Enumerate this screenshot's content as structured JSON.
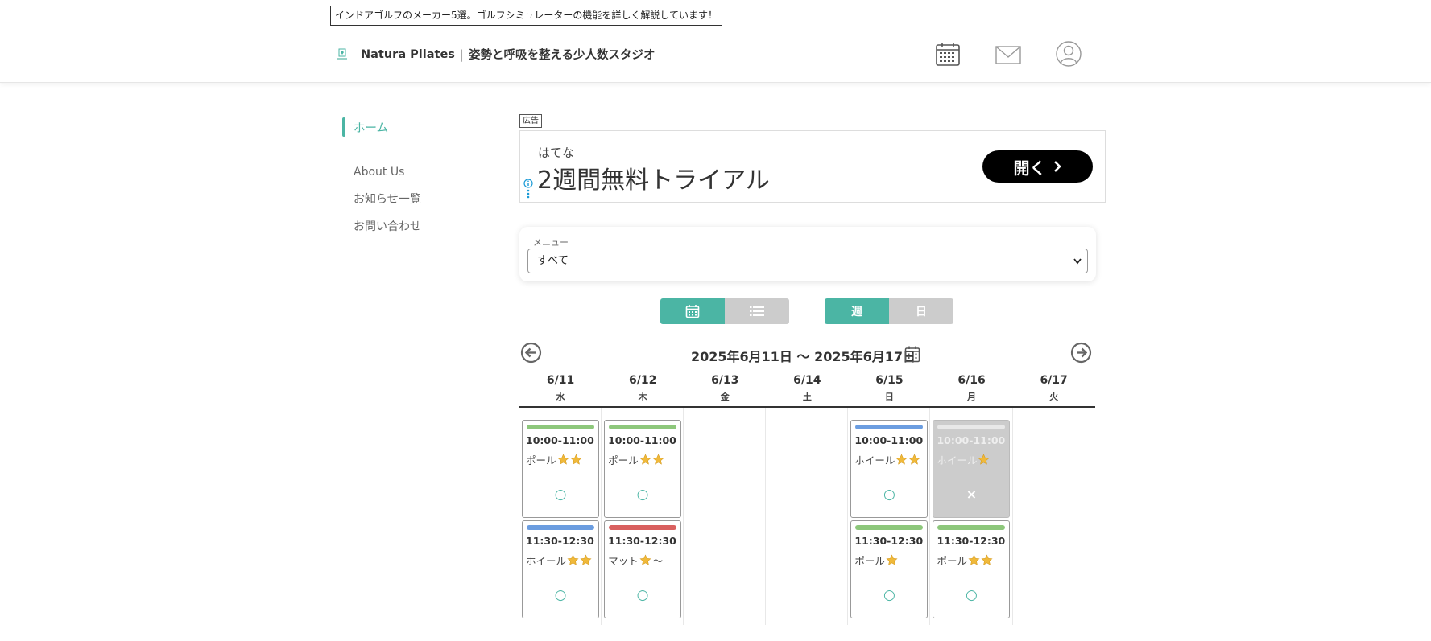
{
  "top_banner": "インドアゴルフのメーカー5選。ゴルフシミュレーターの機能を詳しく解説しています！",
  "brand": {
    "name": "Natura Pilates",
    "separator": "|",
    "tagline": "姿勢と呼吸を整える少人数スタジオ"
  },
  "header_icons": [
    "calendar-icon",
    "mail-icon",
    "user-icon"
  ],
  "sidebar": {
    "home": "ホーム",
    "items": [
      "About Us",
      "お知らせ一覧",
      "お問い合わせ"
    ]
  },
  "ad": {
    "label": "広告",
    "brand": "はてな",
    "title": "2週間無料トライアル",
    "button": "開く"
  },
  "menu": {
    "label": "メニュー",
    "selected": "すべて"
  },
  "view_toggle": {
    "period_week": "週",
    "period_day": "日"
  },
  "week": {
    "range": "2025年6月11日 〜 2025年6月17日"
  },
  "colors": {
    "accent": "#4bb5a4",
    "pole": "#8dc77b",
    "wheel": "#6b9de0",
    "mat": "#d9605f",
    "disabled": "#cccccc",
    "star": "#f0b93a"
  },
  "days": [
    {
      "date": "6/11",
      "weekday": "水",
      "slots": [
        {
          "time": "10:00-11:00",
          "name": "ポール",
          "stars": 2,
          "suffix": "",
          "status": "○",
          "color": "#8dc77b",
          "full": false
        },
        {
          "time": "11:30-12:30",
          "name": "ホイール",
          "stars": 2,
          "suffix": "",
          "status": "○",
          "color": "#6b9de0",
          "full": false
        }
      ]
    },
    {
      "date": "6/12",
      "weekday": "木",
      "slots": [
        {
          "time": "10:00-11:00",
          "name": "ポール",
          "stars": 2,
          "suffix": "",
          "status": "○",
          "color": "#8dc77b",
          "full": false
        },
        {
          "time": "11:30-12:30",
          "name": "マット",
          "stars": 1,
          "suffix": "〜",
          "status": "○",
          "color": "#d9605f",
          "full": false
        }
      ]
    },
    {
      "date": "6/13",
      "weekday": "金",
      "slots": []
    },
    {
      "date": "6/14",
      "weekday": "土",
      "slots": []
    },
    {
      "date": "6/15",
      "weekday": "日",
      "slots": [
        {
          "time": "10:00-11:00",
          "name": "ホイール",
          "stars": 2,
          "suffix": "",
          "status": "○",
          "color": "#6b9de0",
          "full": false
        },
        {
          "time": "11:30-12:30",
          "name": "ポール",
          "stars": 1,
          "suffix": "",
          "status": "○",
          "color": "#8dc77b",
          "full": false
        }
      ]
    },
    {
      "date": "6/16",
      "weekday": "月",
      "slots": [
        {
          "time": "10:00-11:00",
          "name": "ホイール",
          "stars": 1,
          "suffix": "",
          "status": "×",
          "color": "#e8e8e8",
          "full": true
        },
        {
          "time": "11:30-12:30",
          "name": "ポール",
          "stars": 2,
          "suffix": "",
          "status": "○",
          "color": "#8dc77b",
          "full": false
        }
      ]
    },
    {
      "date": "6/17",
      "weekday": "火",
      "slots": []
    }
  ]
}
